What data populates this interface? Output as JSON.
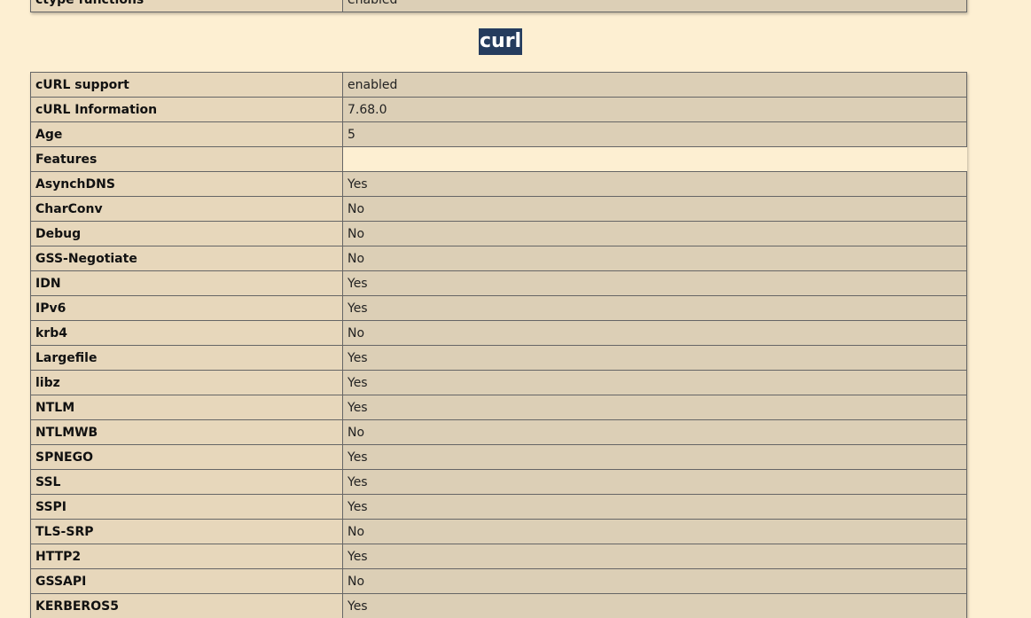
{
  "top_row": {
    "name": "ctype functions",
    "value": "enabled"
  },
  "section": {
    "title": "curl"
  },
  "rows": [
    {
      "name": "cURL support",
      "value": "enabled"
    },
    {
      "name": "cURL Information",
      "value": "7.68.0"
    },
    {
      "name": "Age",
      "value": "5"
    },
    {
      "name": "Features",
      "value": ""
    },
    {
      "name": "AsynchDNS",
      "value": "Yes"
    },
    {
      "name": "CharConv",
      "value": "No"
    },
    {
      "name": "Debug",
      "value": "No"
    },
    {
      "name": "GSS-Negotiate",
      "value": "No"
    },
    {
      "name": "IDN",
      "value": "Yes"
    },
    {
      "name": "IPv6",
      "value": "Yes"
    },
    {
      "name": "krb4",
      "value": "No"
    },
    {
      "name": "Largefile",
      "value": "Yes"
    },
    {
      "name": "libz",
      "value": "Yes"
    },
    {
      "name": "NTLM",
      "value": "Yes"
    },
    {
      "name": "NTLMWB",
      "value": "No"
    },
    {
      "name": "SPNEGO",
      "value": "Yes"
    },
    {
      "name": "SSL",
      "value": "Yes"
    },
    {
      "name": "SSPI",
      "value": "Yes"
    },
    {
      "name": "TLS-SRP",
      "value": "No"
    },
    {
      "name": "HTTP2",
      "value": "Yes"
    },
    {
      "name": "GSSAPI",
      "value": "No"
    },
    {
      "name": "KERBEROS5",
      "value": "Yes"
    }
  ]
}
